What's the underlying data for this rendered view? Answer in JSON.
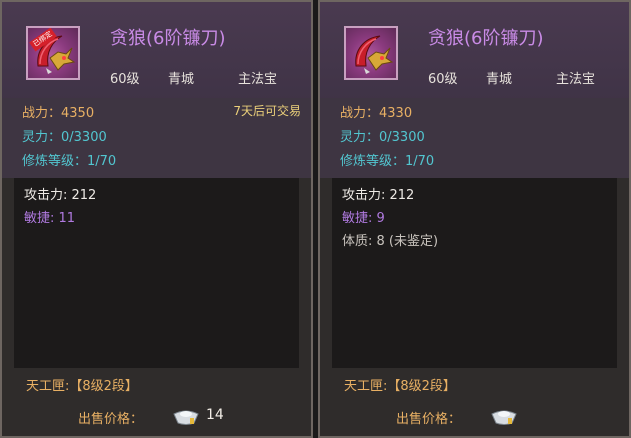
{
  "panels": [
    {
      "name": "贪狼(6阶镰刀)",
      "level": "60级",
      "sect": "青城",
      "type": "主法宝",
      "bound_tag": "已绑定",
      "power": "战力：4350",
      "trade": "7天后可交易",
      "spirit": "灵力：0/3300",
      "cultivate": "修炼等级：1/70",
      "attrs": [
        {
          "text": "攻击力: 212",
          "color": "white"
        },
        {
          "text": "敏捷: 11",
          "color": "purple"
        }
      ],
      "forge": "天工匣:【8级2段】",
      "price_label": "出售价格：",
      "price": "14",
      "icon": "scythe-weapon-icon"
    },
    {
      "name": "贪狼(6阶镰刀)",
      "level": "60级",
      "sect": "青城",
      "type": "主法宝",
      "power": "战力：4330",
      "spirit": "灵力：0/3300",
      "cultivate": "修炼等级：1/70",
      "attrs": [
        {
          "text": "攻击力: 212",
          "color": "white"
        },
        {
          "text": "敏捷: 9",
          "color": "purple"
        },
        {
          "text": "体质: 8 (未鉴定)",
          "color": "grey"
        }
      ],
      "forge": "天工匣:【8级2段】",
      "price_label": "出售价格：",
      "price": "",
      "icon": "scythe-weapon-icon"
    }
  ],
  "colors": {
    "name": "#c98be6",
    "power": "#e8b064",
    "spirit": "#52c6d0",
    "trade": "#ebd07a",
    "attr_purple": "#b07ae0"
  }
}
